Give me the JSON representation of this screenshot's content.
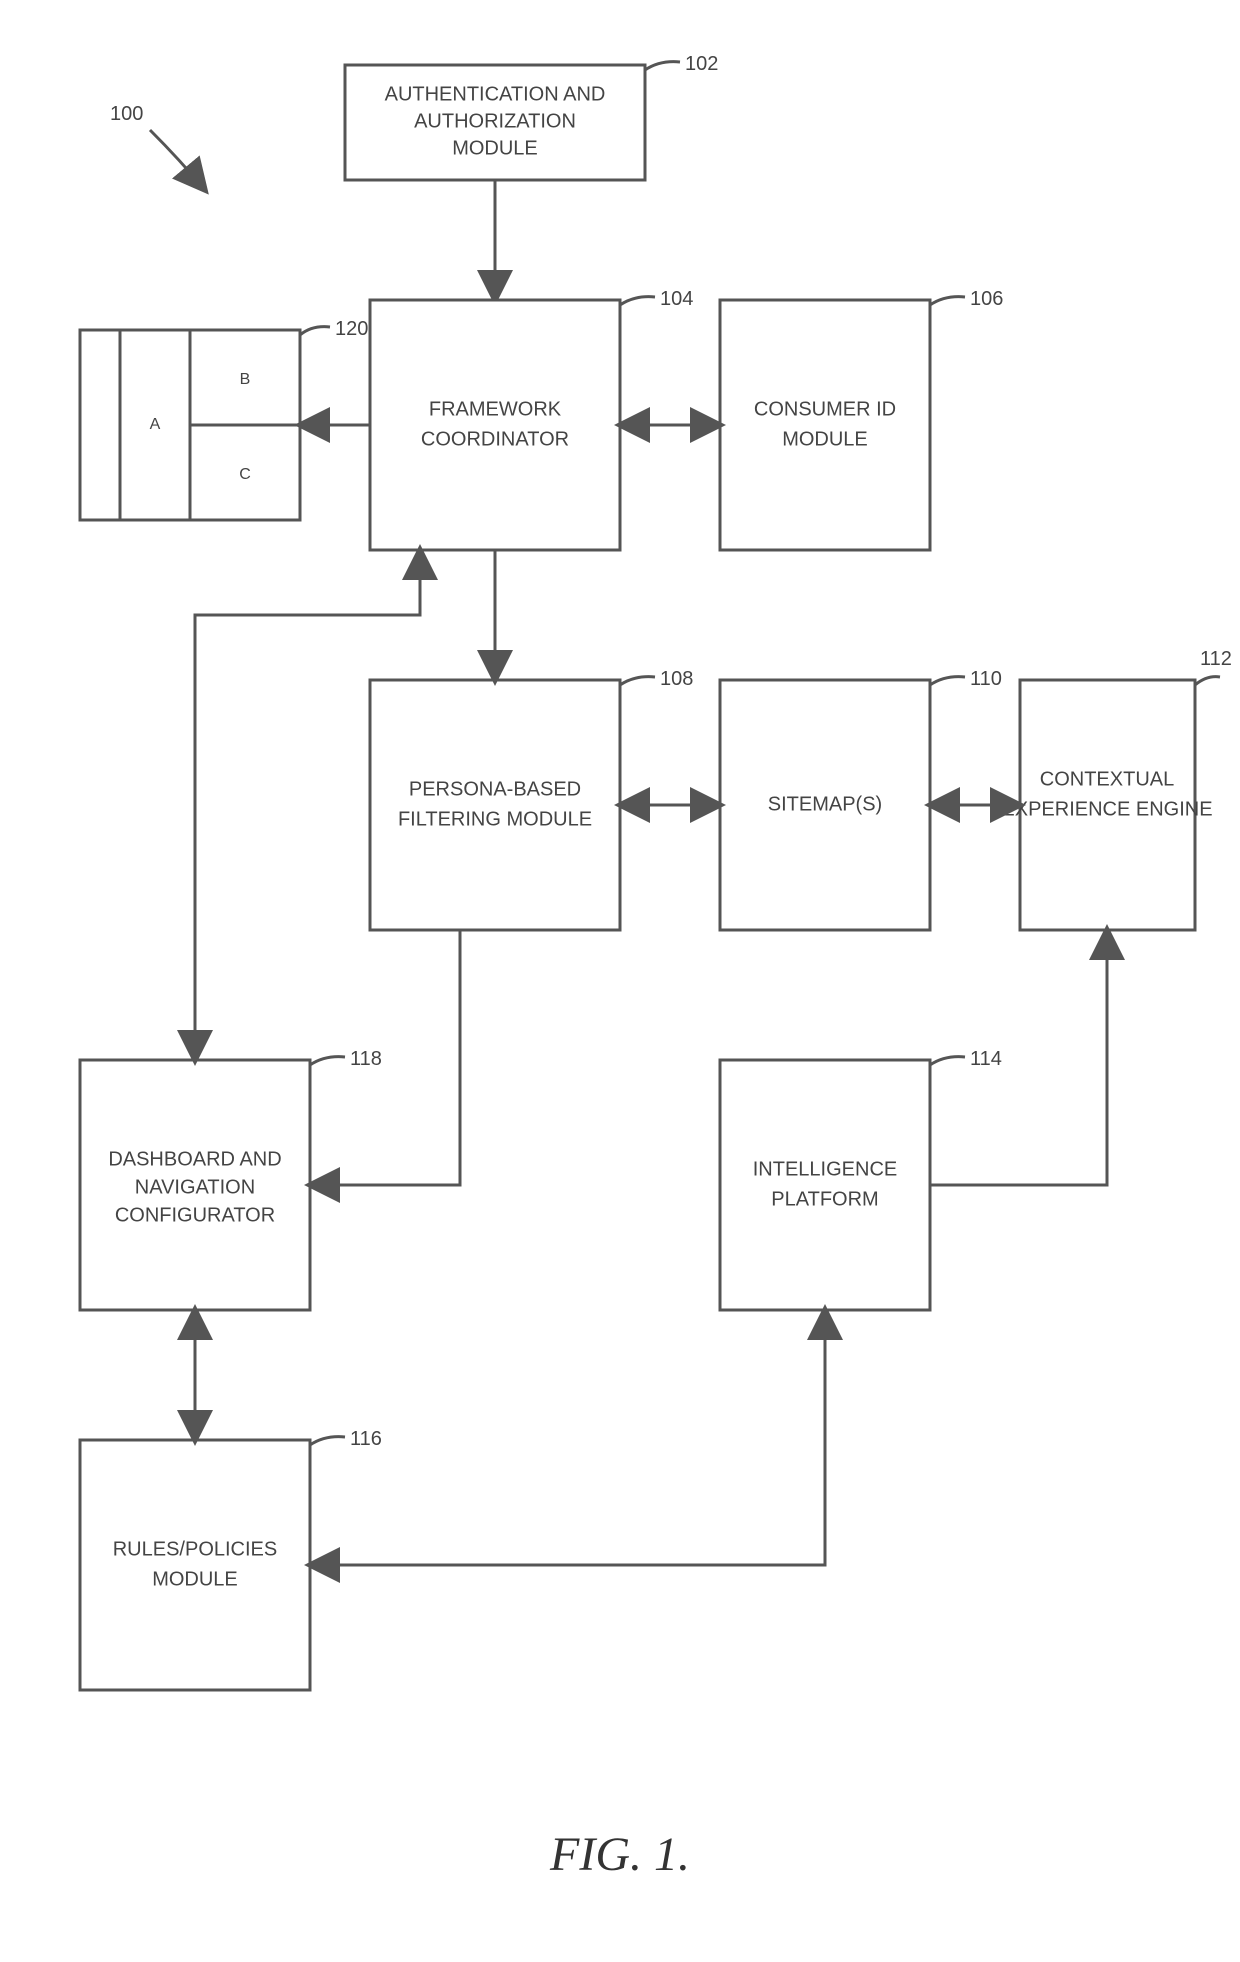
{
  "figure": {
    "label": "FIG. 1.",
    "sys_ref": "100",
    "nodes": {
      "n102": {
        "ref": "102",
        "lines": [
          "AUTHENTICATION AND",
          "AUTHORIZATION",
          "MODULE"
        ]
      },
      "n104": {
        "ref": "104",
        "lines": [
          "FRAMEWORK",
          "COORDINATOR"
        ]
      },
      "n106": {
        "ref": "106",
        "lines": [
          "CONSUMER ID",
          "MODULE"
        ]
      },
      "n108": {
        "ref": "108",
        "lines": [
          "PERSONA-BASED",
          "FILTERING MODULE"
        ]
      },
      "n110": {
        "ref": "110",
        "lines": [
          "SITEMAP(S)"
        ]
      },
      "n112": {
        "ref": "112",
        "lines": [
          "CONTEXTUAL",
          "EXPERIENCE ENGINE"
        ]
      },
      "n114": {
        "ref": "114",
        "lines": [
          "INTELLIGENCE",
          "PLATFORM"
        ]
      },
      "n116": {
        "ref": "116",
        "lines": [
          "RULES/POLICIES",
          "MODULE"
        ]
      },
      "n118": {
        "ref": "118",
        "lines": [
          "DASHBOARD AND",
          "NAVIGATION",
          "CONFIGURATOR"
        ]
      },
      "n120": {
        "ref": "120",
        "cells": [
          "A",
          "B",
          "C"
        ]
      }
    }
  }
}
